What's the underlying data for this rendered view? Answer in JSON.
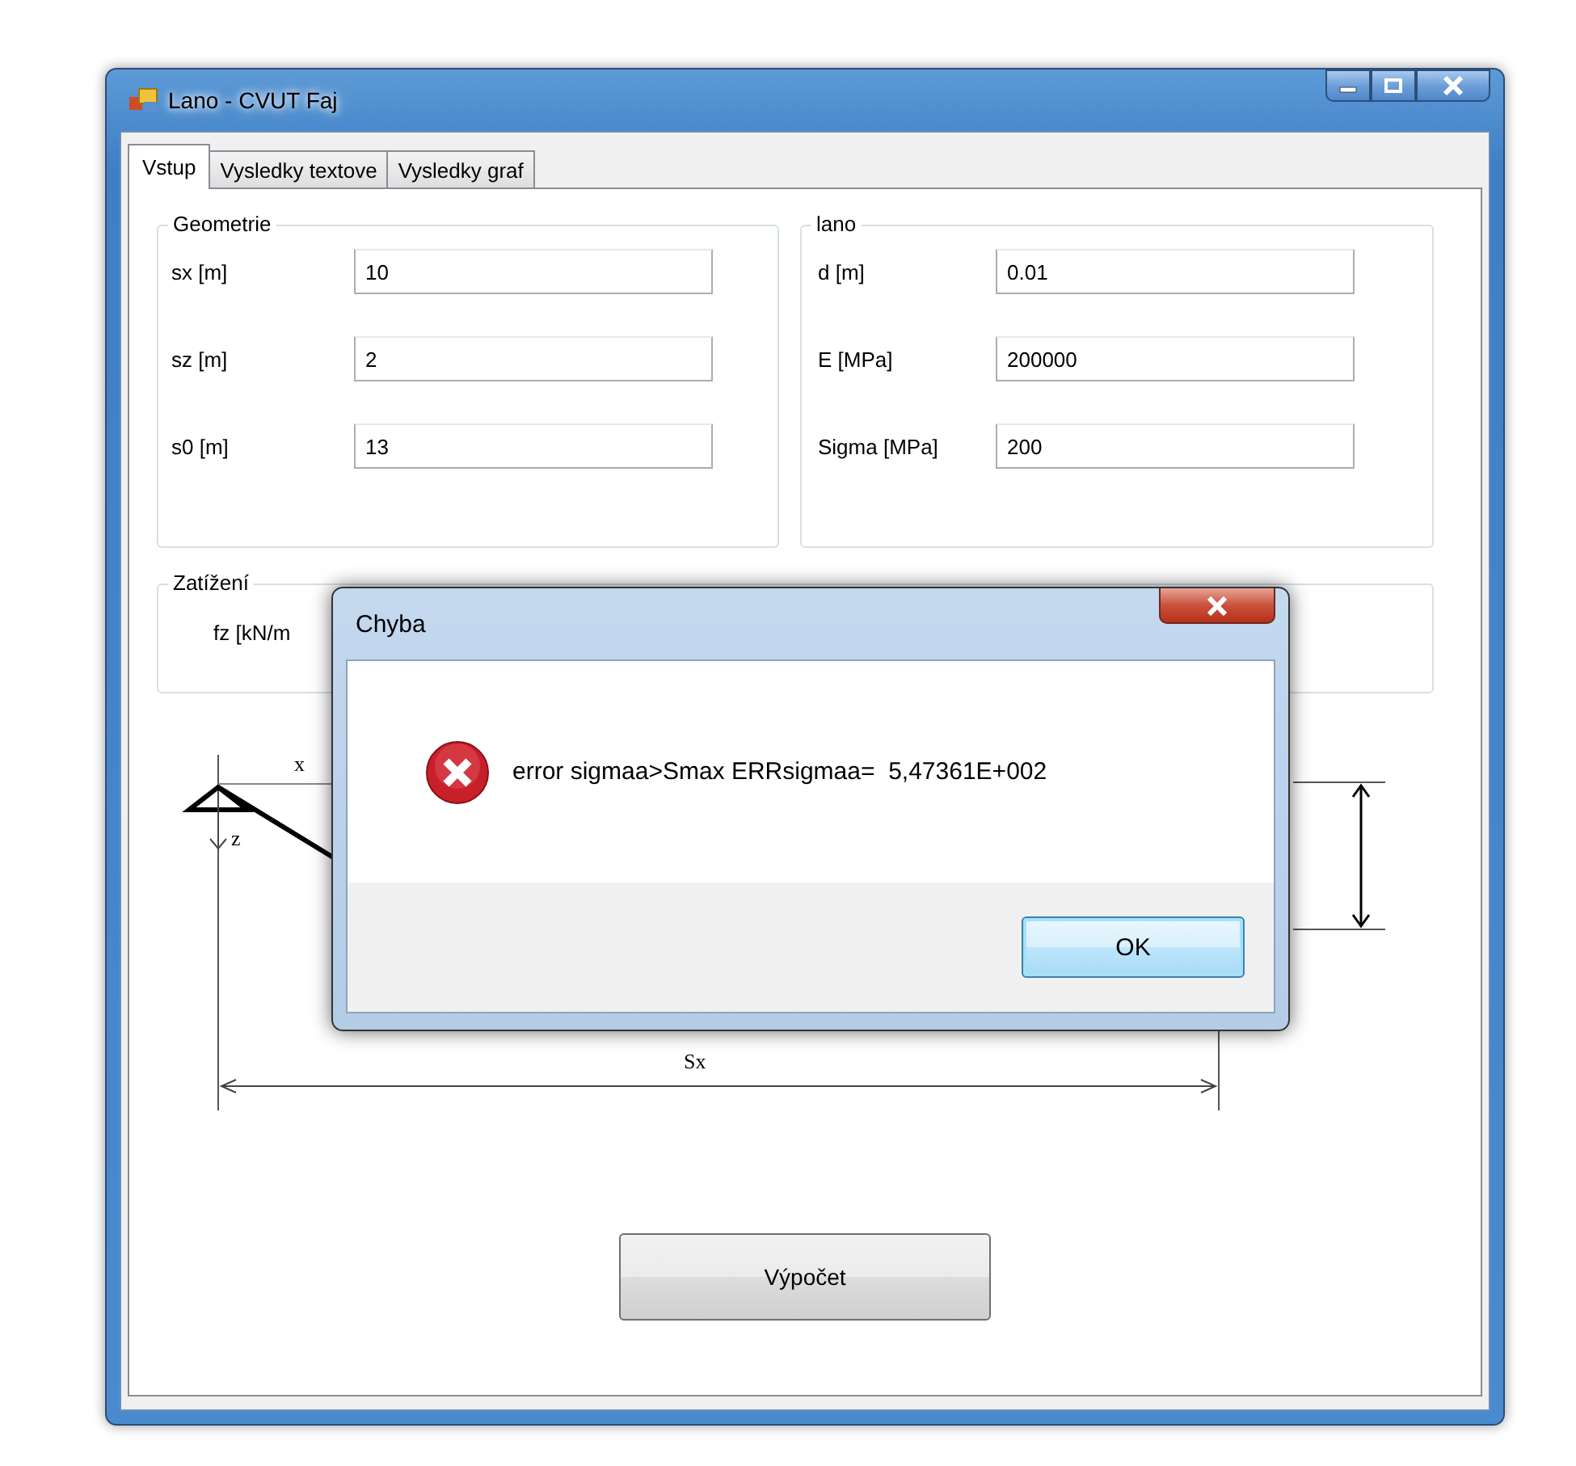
{
  "window": {
    "title": "Lano - CVUT Faj"
  },
  "tabs": [
    {
      "label": "Vstup",
      "selected": true
    },
    {
      "label": "Vysledky textove",
      "selected": false
    },
    {
      "label": "Vysledky graf",
      "selected": false
    }
  ],
  "groups": [
    {
      "title": "Geometrie",
      "fields": [
        {
          "label": "sx [m]",
          "value": "10"
        },
        {
          "label": "sz [m]",
          "value": "2"
        },
        {
          "label": "s0 [m]",
          "value": "13"
        }
      ]
    },
    {
      "title": "lano",
      "fields": [
        {
          "label": "d [m]",
          "value": "0.01"
        },
        {
          "label": "E [MPa]",
          "value": "200000"
        },
        {
          "label": "Sigma [MPa]",
          "value": "200"
        }
      ]
    }
  ],
  "load_group": {
    "title": "Zatížení",
    "label": "fz  [kN/m"
  },
  "diagram": {
    "x_label": "x",
    "z_label": "z",
    "span_label": "Sx"
  },
  "calculate_button": "Výpočet",
  "dialog": {
    "title": "Chyba",
    "message": "error sigmaa>Smax ERRsigmaa=  5,47361E+002",
    "button": "OK"
  }
}
